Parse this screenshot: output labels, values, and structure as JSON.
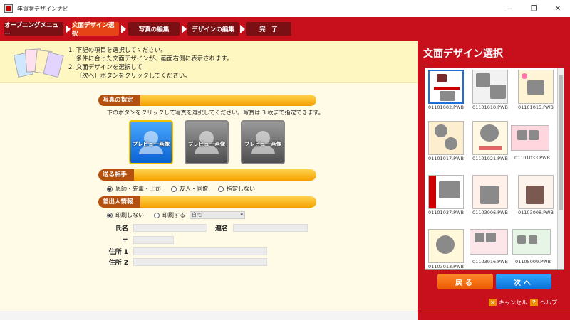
{
  "window": {
    "title": "年賀状デザインナビ",
    "min": "—",
    "restore": "❐",
    "close": "✕"
  },
  "steps": [
    "オープニングメニュー",
    "文面デザイン選択",
    "写真の編集",
    "デザインの編集",
    "完　了"
  ],
  "active_step": 1,
  "instructions": {
    "line1": "1. 下記の項目を選択してください。",
    "line2": "    条件に合った文面デザインが、画面右側に表示されます。",
    "line3": "2. 文面デザインを選択して",
    "line4": "    〔次へ〕ボタンをクリックしてください。"
  },
  "photo_section": {
    "title": "写真の指定",
    "instruction": "下のボタンをクリックして写真を選択してください。写真は 3 枚まで指定できます。",
    "previews": [
      "プレビュー画像",
      "プレビュー画像",
      "プレビュー画像"
    ]
  },
  "recipient_section": {
    "title": "送る相手",
    "options": [
      "恩師・先輩・上司",
      "友人・同僚",
      "指定しない"
    ],
    "selected": 0
  },
  "sender_section": {
    "title": "差出人情報",
    "options": [
      "印刷しない",
      "印刷する"
    ],
    "selected": 0,
    "select_value": "自宅",
    "fields": {
      "name": "氏名",
      "joint": "連名",
      "postal": "〒",
      "addr1": "住所 1",
      "addr2": "住所 2"
    }
  },
  "right_panel": {
    "title": "文面デザイン選択",
    "thumbs": [
      "01101002.PWB",
      "01101010.PWB",
      "01101015.PWB",
      "01101017.PWB",
      "01101021.PWB",
      "01101033.PWB",
      "01101037.PWB",
      "01103006.PWB",
      "01103008.PWB",
      "01103013.PWB",
      "01103016.PWB",
      "01105009.PWB"
    ],
    "selected_thumb": 0,
    "back": "戻る",
    "next": "次へ",
    "cancel": "キャンセル",
    "help": "ヘルプ"
  },
  "colors": {
    "accent_red": "#c8101c",
    "step_dark": "#7a0f14",
    "step_active": "#e64416",
    "back_orange": "#ec5a00",
    "next_blue": "#0a6fd6"
  }
}
